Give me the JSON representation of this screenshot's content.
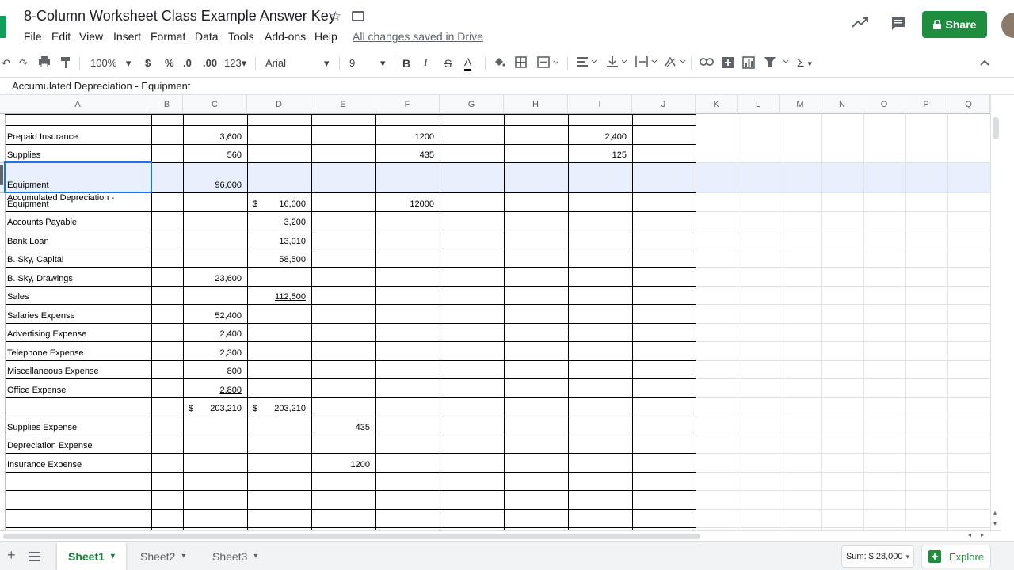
{
  "app": {
    "doc_title": "8-Column Worksheet Class Example Answer Key",
    "save_status": "All changes saved in Drive",
    "share_label": "Share",
    "brand_color": "#1e8e3e"
  },
  "menu": [
    "File",
    "Edit",
    "View",
    "Insert",
    "Format",
    "Data",
    "Tools",
    "Add-ons",
    "Help"
  ],
  "toolbar": {
    "zoom": "100%",
    "currency": "$",
    "percent": "%",
    "dec_decrease": ".0",
    "dec_increase": ".00",
    "format_more": "123",
    "font": "Arial",
    "font_size": "9",
    "bold": "B",
    "italic": "I",
    "strike": "S",
    "text_color": "A",
    "functions": "Σ"
  },
  "formula_bar": {
    "content": "Accumulated Depreciation - Equipment"
  },
  "columns": [
    "A",
    "B",
    "C",
    "D",
    "E",
    "F",
    "G",
    "H",
    "I",
    "J",
    "K",
    "L",
    "M",
    "N",
    "O",
    "P",
    "Q"
  ],
  "rows": [
    {
      "a": "Prepaid Insurance",
      "c": "3,600",
      "f": "1200",
      "i": "2,400"
    },
    {
      "a": "Supplies",
      "c": "560",
      "f": "435",
      "i": "125"
    },
    {
      "a": "Equipment",
      "c": "96,000"
    },
    {
      "a": "Accumulated Depreciation -",
      "a2": "Equipment",
      "d_sym": "$",
      "d": "16,000",
      "f": "12000"
    },
    {
      "a": "Accounts Payable",
      "d": "3,200"
    },
    {
      "a": "Bank Loan",
      "d": "13,010"
    },
    {
      "a": "B. Sky, Capital",
      "d": "58,500"
    },
    {
      "a": "B. Sky, Drawings",
      "c": "23,600"
    },
    {
      "a": "Sales",
      "d": "112,500"
    },
    {
      "a": "Salaries Expense",
      "c": "52,400"
    },
    {
      "a": "Advertising Expense",
      "c": "2,400"
    },
    {
      "a": "Telephone Expense",
      "c": "2,300"
    },
    {
      "a": "Miscellaneous Expense",
      "c": "800"
    },
    {
      "a": "Office Expense",
      "c": "2,800"
    },
    {
      "c_sym": "$",
      "c": "203,210",
      "d_sym": "$",
      "d": "203,210"
    },
    {
      "a": "Supplies Expense",
      "e": "435"
    },
    {
      "a": "Depreciation Expense"
    },
    {
      "a": "Insurance Expense",
      "e": "1200"
    }
  ],
  "sheets": [
    {
      "label": "Sheet1",
      "active": true
    },
    {
      "label": "Sheet2",
      "active": false
    },
    {
      "label": "Sheet3",
      "active": false
    }
  ],
  "status": {
    "sum": "Sum: $ 28,000",
    "explore": "Explore"
  }
}
